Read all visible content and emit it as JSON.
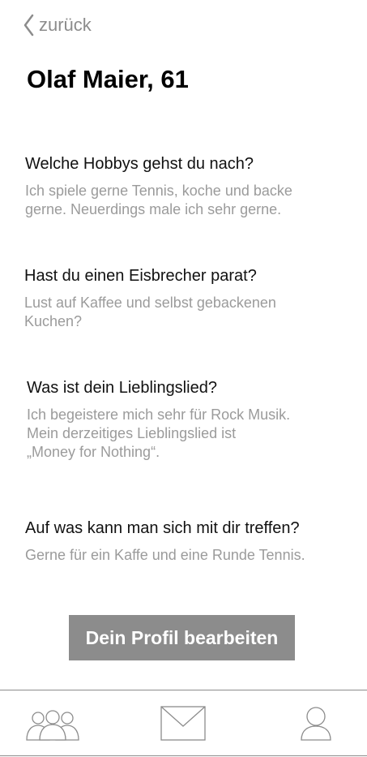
{
  "header": {
    "back_label": "zurück",
    "title": "Olaf Maier, 61"
  },
  "questions": [
    {
      "question": "Welche Hobbys gehst du nach?",
      "answer_lines": [
        "Ich spiele gerne Tennis, koche und backe",
        "gerne. Neuerdings male ich sehr gerne."
      ]
    },
    {
      "question": "Hast du einen Eisbrecher parat?",
      "answer_lines": [
        "Lust auf Kaffee und selbst gebackenen",
        "Kuchen?"
      ]
    },
    {
      "question": "Was ist dein Lieblingslied?",
      "answer_lines": [
        "Ich begeistere mich sehr für Rock Musik.",
        "Mein derzeitiges Lieblingslied ist",
        "„Money for Nothing“."
      ]
    },
    {
      "question": "Auf was kann man sich mit dir treffen?",
      "answer_lines": [
        "Gerne für ein Kaffe und eine Runde Tennis."
      ]
    }
  ],
  "edit_button_label": "Dein Profil bearbeiten",
  "bottom_nav": {
    "items": [
      {
        "icon": "group-icon"
      },
      {
        "icon": "mail-icon"
      },
      {
        "icon": "user-icon"
      }
    ]
  }
}
